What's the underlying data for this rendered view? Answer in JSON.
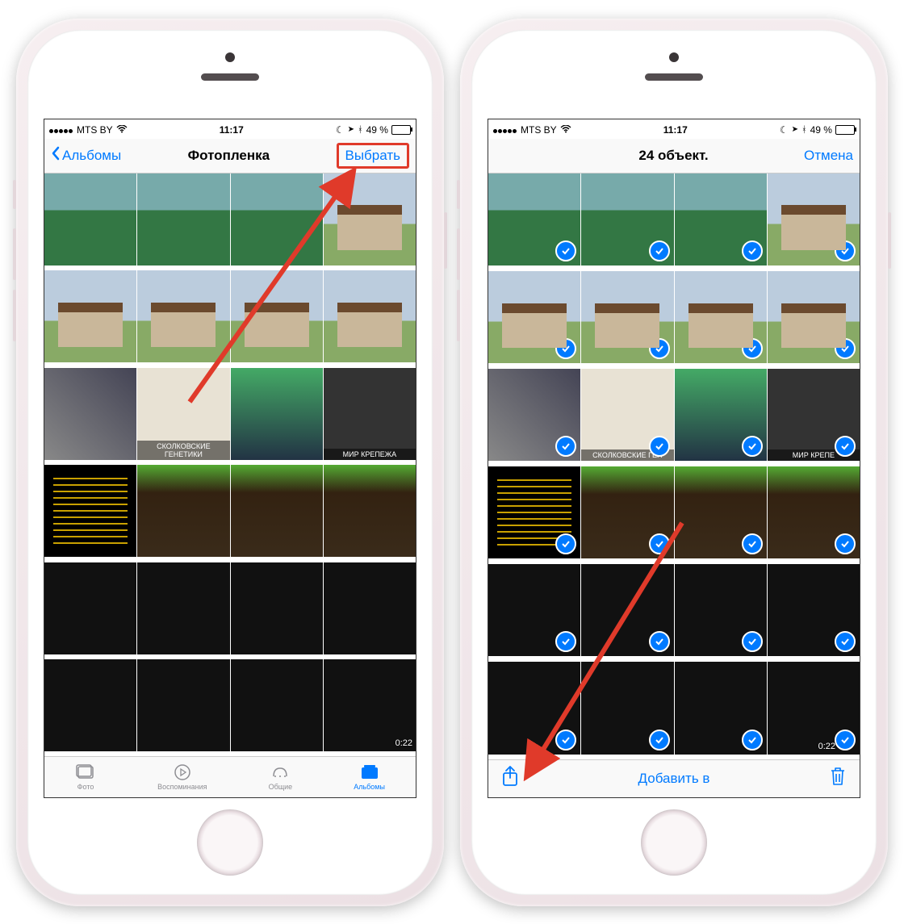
{
  "status": {
    "carrier": "MTS BY",
    "time": "11:17",
    "battery_pct": "49 %"
  },
  "phone1": {
    "nav": {
      "back": "Альбомы",
      "title": "Фотопленка",
      "select": "Выбрать"
    },
    "video_duration": "0:22",
    "thumb_label_mir": "МИР КРЕПЕЖА",
    "thumb_label_skol": "СКОЛКОВСКИЕ ГЕНЕТИКИ",
    "tabs": {
      "photo": "Фото",
      "memories": "Воспоминания",
      "shared": "Общие",
      "albums": "Альбомы"
    }
  },
  "phone2": {
    "nav": {
      "title": "24 объект.",
      "cancel": "Отмена"
    },
    "video_duration": "0:22",
    "thumb_label_mir": "МИР КРЕПЕ",
    "thumb_label_skol": "СКОЛКОВСКИЕ ГЕН",
    "toolbar": {
      "add_to": "Добавить в"
    }
  }
}
